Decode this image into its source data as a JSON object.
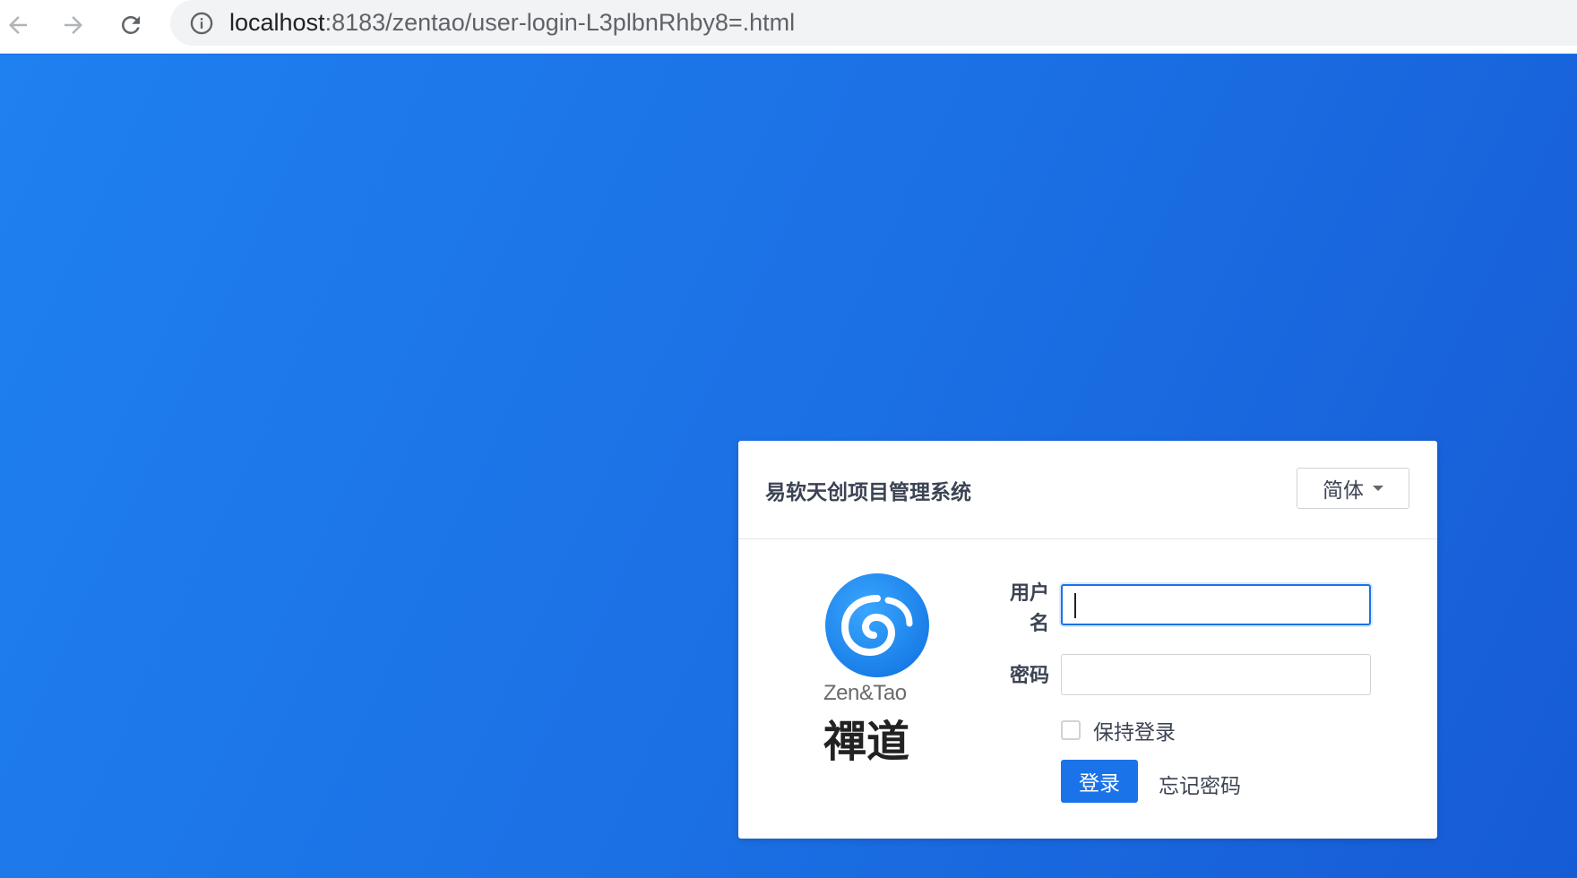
{
  "browser": {
    "url_host": "localhost",
    "url_rest": ":8183/zentao/user-login-L3plbnRhby8=.html",
    "icons": [
      "back-arrow-icon",
      "forward-arrow-icon",
      "reload-icon",
      "info-icon"
    ]
  },
  "login": {
    "title": "易软天创项目管理系统",
    "language": "简体",
    "logo_text_en": "Zen&Tao",
    "logo_text_cn": "禪道",
    "username_label_line1": "用户",
    "username_label_line2": "名",
    "username_value": "",
    "password_label": "密码",
    "password_value": "",
    "keep_login_label": "保持登录",
    "keep_login_checked": false,
    "login_button": "登录",
    "forgot_password": "忘记密码"
  },
  "colors": {
    "background": "#1a73e8",
    "primary_button": "#1a73e8",
    "panel": "#ffffff"
  }
}
